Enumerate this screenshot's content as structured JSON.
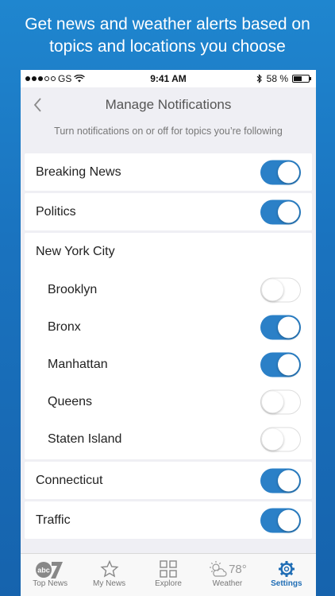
{
  "headline": {
    "line1": "Get news and weather alerts based on",
    "line2": "topics and locations you choose"
  },
  "status_bar": {
    "carrier": "GS",
    "time": "9:41 AM",
    "battery": "58 %",
    "battery_level": 0.58
  },
  "nav": {
    "title": "Manage Notifications",
    "subtitle": "Turn notifications on or off for topics you’re following"
  },
  "topics": [
    {
      "label": "Breaking News",
      "on": true
    },
    {
      "label": "Politics",
      "on": true
    }
  ],
  "nyc": {
    "header": "New York City",
    "items": [
      {
        "label": "Brooklyn",
        "on": false
      },
      {
        "label": "Bronx",
        "on": true
      },
      {
        "label": "Manhattan",
        "on": true
      },
      {
        "label": "Queens",
        "on": false
      },
      {
        "label": "Staten Island",
        "on": false
      }
    ]
  },
  "topics2": [
    {
      "label": "Connecticut",
      "on": true
    },
    {
      "label": "Traffic",
      "on": true
    }
  ],
  "tabbar": {
    "tabs": [
      {
        "label": "Top News",
        "icon": "abc7-logo-icon"
      },
      {
        "label": "My News",
        "icon": "star-icon"
      },
      {
        "label": "Explore",
        "icon": "grid-icon"
      },
      {
        "label": "Weather",
        "icon": "partly-sunny-icon",
        "temp": "78°"
      },
      {
        "label": "Settings",
        "icon": "gear-icon",
        "active": true
      }
    ]
  },
  "colors": {
    "accent": "#2b80c7",
    "background": "#1a73bf"
  }
}
